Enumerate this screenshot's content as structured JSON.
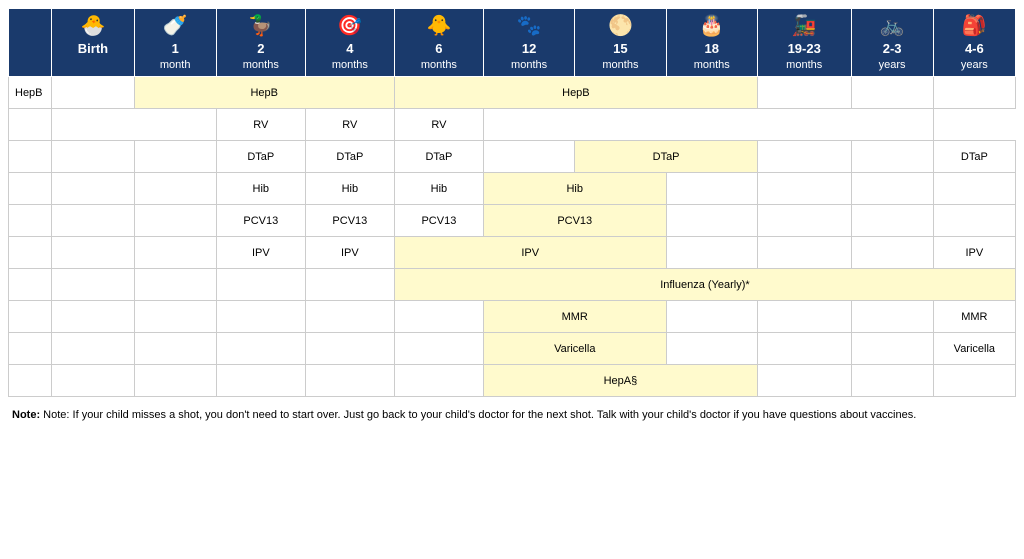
{
  "header": {
    "columns": [
      {
        "id": "birth",
        "icon": "🐣",
        "label_main": "Birth",
        "label_sub": ""
      },
      {
        "id": "1m",
        "icon": "🍼",
        "label_main": "1",
        "label_sub": "month"
      },
      {
        "id": "2m",
        "icon": "🦆",
        "label_main": "2",
        "label_sub": "months"
      },
      {
        "id": "4m",
        "icon": "🎯",
        "label_main": "4",
        "label_sub": "months"
      },
      {
        "id": "6m",
        "icon": "🐥",
        "label_main": "6",
        "label_sub": "months"
      },
      {
        "id": "12m",
        "icon": "🐾",
        "label_main": "12",
        "label_sub": "months"
      },
      {
        "id": "15m",
        "icon": "🌕",
        "label_main": "15",
        "label_sub": "months"
      },
      {
        "id": "18m",
        "icon": "🎂",
        "label_main": "18",
        "label_sub": "months"
      },
      {
        "id": "1923m",
        "icon": "🚂",
        "label_main": "19-23",
        "label_sub": "months"
      },
      {
        "id": "23y",
        "icon": "🚲",
        "label_main": "2-3",
        "label_sub": "years"
      },
      {
        "id": "46y",
        "icon": "🎒",
        "label_main": "4-6",
        "label_sub": "years"
      }
    ]
  },
  "rows": [
    {
      "label": "HepB",
      "cells": [
        {
          "col": "birth",
          "text": "",
          "style": "white"
        },
        {
          "col": "1m_4m",
          "text": "HepB",
          "colspan": 3,
          "style": "yellow"
        },
        {
          "col": "6m_18m",
          "text": "HepB",
          "colspan": 4,
          "style": "yellow"
        },
        {
          "col": "1923m",
          "text": "",
          "style": "white"
        },
        {
          "col": "23y",
          "text": "",
          "style": "white"
        },
        {
          "col": "46y",
          "text": "",
          "style": "white"
        }
      ]
    },
    {
      "label": "",
      "cells": [
        {
          "col": "birth",
          "text": "",
          "style": "white"
        },
        {
          "col": "1m",
          "text": "",
          "style": "white"
        },
        {
          "col": "2m",
          "text": "RV",
          "style": "white"
        },
        {
          "col": "4m",
          "text": "RV",
          "style": "white"
        },
        {
          "col": "6m",
          "text": "RV",
          "style": "white"
        },
        {
          "col": "12m",
          "text": "",
          "style": "white"
        },
        {
          "col": "15m",
          "text": "",
          "style": "white"
        },
        {
          "col": "18m",
          "text": "",
          "style": "white"
        },
        {
          "col": "1923m",
          "text": "",
          "style": "white"
        },
        {
          "col": "23y",
          "text": "",
          "style": "white"
        },
        {
          "col": "46y",
          "text": "",
          "style": "white"
        }
      ]
    },
    {
      "label": "",
      "cells": [
        {
          "col": "birth",
          "text": "",
          "style": "white"
        },
        {
          "col": "1m",
          "text": "",
          "style": "white"
        },
        {
          "col": "2m",
          "text": "DTaP",
          "style": "white"
        },
        {
          "col": "4m",
          "text": "DTaP",
          "style": "white"
        },
        {
          "col": "6m",
          "text": "DTaP",
          "style": "white"
        },
        {
          "col": "12m",
          "text": "",
          "style": "white"
        },
        {
          "col": "15m_18m",
          "text": "DTaP",
          "colspan": 2,
          "style": "yellow"
        },
        {
          "col": "1923m",
          "text": "",
          "style": "white"
        },
        {
          "col": "23y",
          "text": "",
          "style": "white"
        },
        {
          "col": "46y",
          "text": "DTaP",
          "style": "white"
        }
      ]
    },
    {
      "label": "",
      "cells": [
        {
          "col": "birth",
          "text": "",
          "style": "white"
        },
        {
          "col": "1m",
          "text": "",
          "style": "white"
        },
        {
          "col": "2m",
          "text": "Hib",
          "style": "white"
        },
        {
          "col": "4m",
          "text": "Hib",
          "style": "white"
        },
        {
          "col": "6m",
          "text": "Hib",
          "style": "white"
        },
        {
          "col": "12m_15m",
          "text": "Hib",
          "colspan": 2,
          "style": "yellow"
        },
        {
          "col": "18m",
          "text": "",
          "style": "white"
        },
        {
          "col": "1923m",
          "text": "",
          "style": "white"
        },
        {
          "col": "23y",
          "text": "",
          "style": "white"
        },
        {
          "col": "46y",
          "text": "",
          "style": "white"
        }
      ]
    },
    {
      "label": "",
      "cells": [
        {
          "col": "birth",
          "text": "",
          "style": "white"
        },
        {
          "col": "1m",
          "text": "",
          "style": "white"
        },
        {
          "col": "2m",
          "text": "PCV13",
          "style": "white"
        },
        {
          "col": "4m",
          "text": "PCV13",
          "style": "white"
        },
        {
          "col": "6m",
          "text": "PCV13",
          "style": "white"
        },
        {
          "col": "12m_15m",
          "text": "PCV13",
          "colspan": 2,
          "style": "yellow"
        },
        {
          "col": "18m",
          "text": "",
          "style": "white"
        },
        {
          "col": "1923m",
          "text": "",
          "style": "white"
        },
        {
          "col": "23y",
          "text": "",
          "style": "white"
        },
        {
          "col": "46y",
          "text": "",
          "style": "white"
        }
      ]
    },
    {
      "label": "",
      "cells": [
        {
          "col": "birth",
          "text": "",
          "style": "white"
        },
        {
          "col": "1m",
          "text": "",
          "style": "white"
        },
        {
          "col": "2m",
          "text": "IPV",
          "style": "white"
        },
        {
          "col": "4m",
          "text": "IPV",
          "style": "white"
        },
        {
          "col": "6m_15m",
          "text": "IPV",
          "colspan": 3,
          "style": "yellow"
        },
        {
          "col": "18m",
          "text": "",
          "style": "white"
        },
        {
          "col": "1923m",
          "text": "",
          "style": "white"
        },
        {
          "col": "23y",
          "text": "",
          "style": "white"
        },
        {
          "col": "46y",
          "text": "IPV",
          "style": "white"
        }
      ]
    },
    {
      "label": "",
      "cells": [
        {
          "col": "birth",
          "text": "",
          "style": "white"
        },
        {
          "col": "1m",
          "text": "",
          "style": "white"
        },
        {
          "col": "2m",
          "text": "",
          "style": "white"
        },
        {
          "col": "4m",
          "text": "",
          "style": "white"
        },
        {
          "col": "6m_46y",
          "text": "Influenza (Yearly)*",
          "colspan": 7,
          "style": "yellow"
        }
      ]
    },
    {
      "label": "",
      "cells": [
        {
          "col": "birth",
          "text": "",
          "style": "white"
        },
        {
          "col": "1m",
          "text": "",
          "style": "white"
        },
        {
          "col": "2m",
          "text": "",
          "style": "white"
        },
        {
          "col": "4m",
          "text": "",
          "style": "white"
        },
        {
          "col": "6m",
          "text": "",
          "style": "white"
        },
        {
          "col": "12m_15m",
          "text": "MMR",
          "colspan": 2,
          "style": "yellow"
        },
        {
          "col": "18m",
          "text": "",
          "style": "white"
        },
        {
          "col": "1923m",
          "text": "",
          "style": "white"
        },
        {
          "col": "23y",
          "text": "",
          "style": "white"
        },
        {
          "col": "46y",
          "text": "MMR",
          "style": "white"
        }
      ]
    },
    {
      "label": "",
      "cells": [
        {
          "col": "birth",
          "text": "",
          "style": "white"
        },
        {
          "col": "1m",
          "text": "",
          "style": "white"
        },
        {
          "col": "2m",
          "text": "",
          "style": "white"
        },
        {
          "col": "4m",
          "text": "",
          "style": "white"
        },
        {
          "col": "6m",
          "text": "",
          "style": "white"
        },
        {
          "col": "12m_15m",
          "text": "Varicella",
          "colspan": 2,
          "style": "yellow"
        },
        {
          "col": "18m",
          "text": "",
          "style": "white"
        },
        {
          "col": "1923m",
          "text": "",
          "style": "white"
        },
        {
          "col": "23y",
          "text": "",
          "style": "white"
        },
        {
          "col": "46y",
          "text": "Varicella",
          "style": "white"
        }
      ]
    },
    {
      "label": "",
      "cells": [
        {
          "col": "birth",
          "text": "",
          "style": "white"
        },
        {
          "col": "1m",
          "text": "",
          "style": "white"
        },
        {
          "col": "2m",
          "text": "",
          "style": "white"
        },
        {
          "col": "4m",
          "text": "",
          "style": "white"
        },
        {
          "col": "6m",
          "text": "",
          "style": "white"
        },
        {
          "col": "12m_18m",
          "text": "HepA§",
          "colspan": 3,
          "style": "yellow"
        },
        {
          "col": "1923m",
          "text": "",
          "style": "white"
        },
        {
          "col": "23y",
          "text": "",
          "style": "white"
        },
        {
          "col": "46y",
          "text": "",
          "style": "white"
        }
      ]
    }
  ],
  "note": "Note: If your child misses a shot, you don't need to start over. Just go back to your child's doctor for the next shot. Talk with your child's doctor if you have questions about vaccines."
}
